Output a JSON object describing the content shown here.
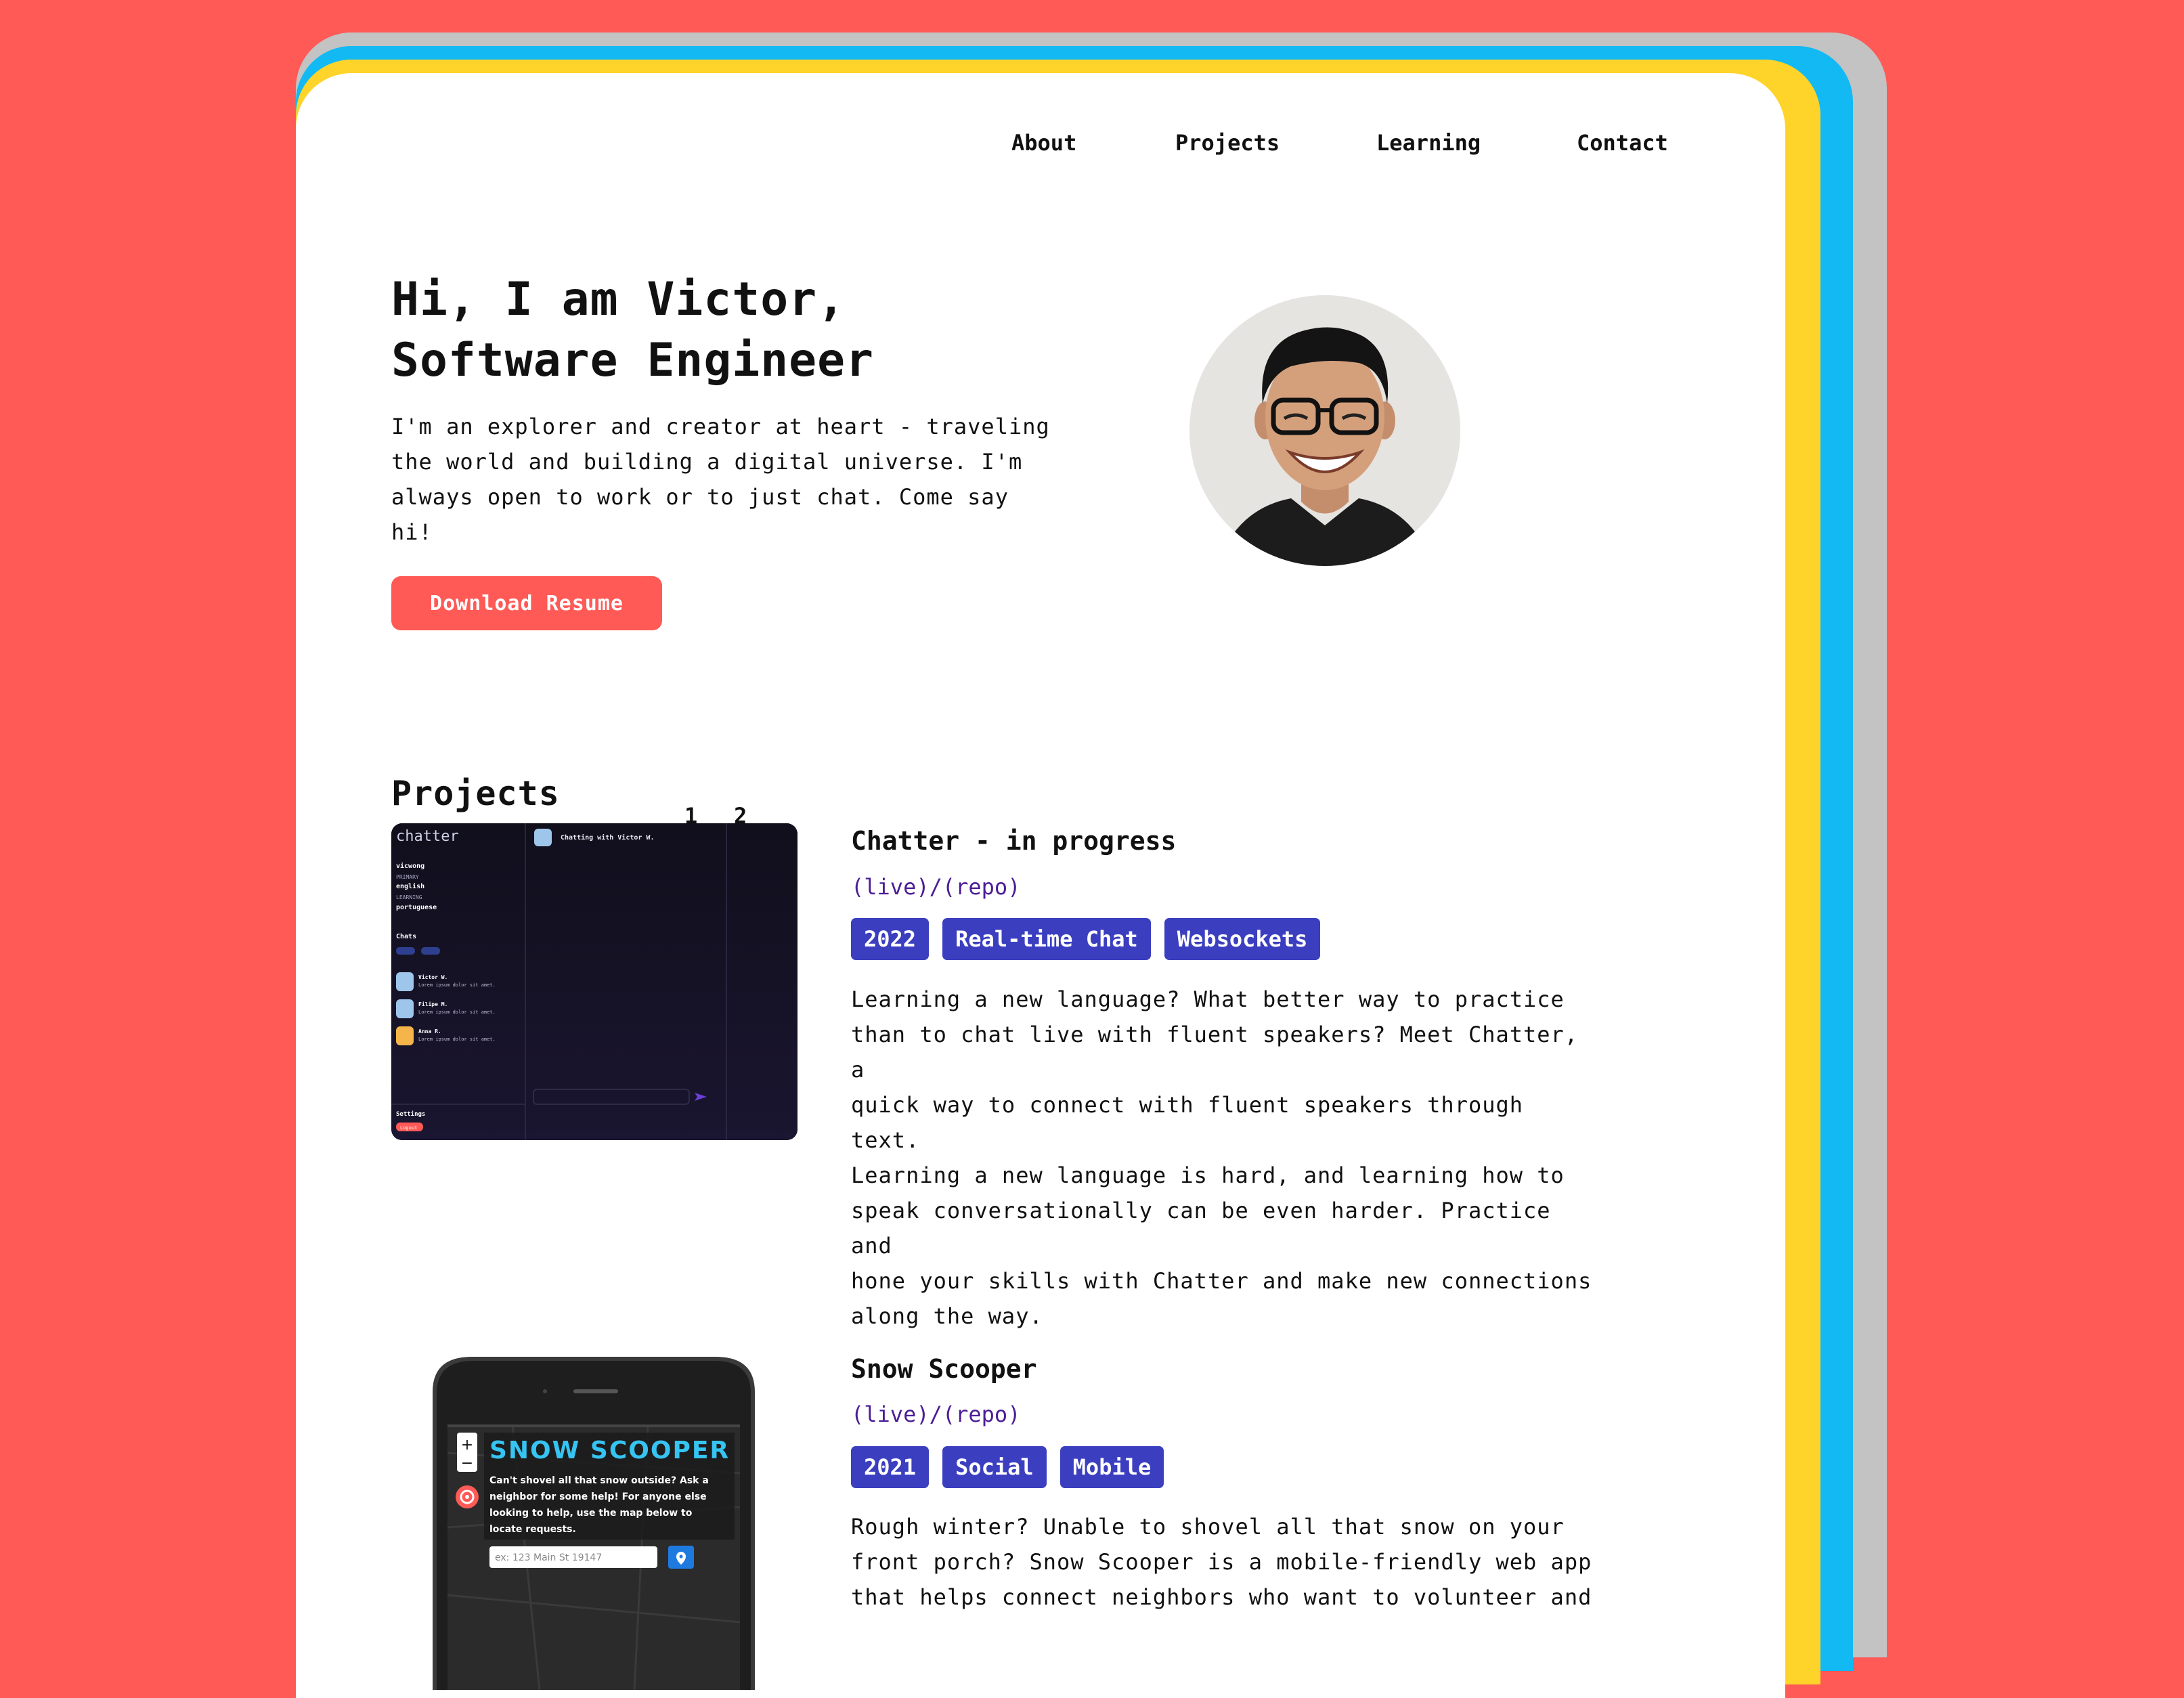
{
  "nav": {
    "about": "About",
    "projects": "Projects",
    "learning": "Learning",
    "contact": "Contact"
  },
  "hero": {
    "title_line1": "Hi, I am Victor,",
    "title_line2": "Software Engineer",
    "intro_line1": "I'm an explorer and creator at heart - traveling",
    "intro_line2": "the world and building a digital universe. I'm",
    "intro_line3": "always open to work or to just chat. Come say hi!",
    "resume_button": "Download Resume"
  },
  "projects_section": {
    "title": "Projects",
    "pages": [
      "1",
      "2"
    ]
  },
  "projects": [
    {
      "title": "Chatter - in progress",
      "live": "(live)",
      "separator": "/",
      "repo": "(repo)",
      "tags": [
        "2022",
        "Real-time Chat",
        "Websockets"
      ],
      "description_lines": [
        "Learning a new language? What better way to practice",
        "than to chat live with fluent speakers? Meet Chatter, a",
        "quick way to connect with fluent speakers through text.",
        "Learning a new language is hard, and learning how to",
        "speak conversationally can be even harder. Practice and",
        "hone your skills with Chatter and make new connections",
        "along the way."
      ],
      "screenshot": {
        "logo": "chatter",
        "header": "Chatting with Victor W.",
        "user": "vicwong",
        "primary_label": "PRIMARY",
        "primary_lang": "english",
        "learning_label": "LEARNING",
        "learning_lang": "portuguese",
        "chats_label": "Chats",
        "chats": [
          {
            "name": "Victor W.",
            "msg": "Lorem ipsum dolor sit amet."
          },
          {
            "name": "Filipe M.",
            "msg": "Lorem ipsum dolor sit amet."
          },
          {
            "name": "Anna R.",
            "msg": "Lorem ipsum dolor sit amet."
          }
        ],
        "settings": "Settings",
        "logout": "Logout"
      }
    },
    {
      "title": "Snow Scooper",
      "live": "(live)",
      "separator": "/",
      "repo": "(repo)",
      "tags": [
        "2021",
        "Social",
        "Mobile"
      ],
      "description_lines": [
        "Rough winter? Unable to shovel all that snow on your",
        "front porch? Snow Scooper is a mobile-friendly web app",
        "that helps connect neighbors who want to volunteer and"
      ],
      "screenshot": {
        "logo": "SNOW SCOOPER",
        "blurb_lines": [
          "Can't shovel all that snow outside? Ask a",
          "neighbor for some help! For anyone else",
          "looking to help, use the map below to",
          "locate requests."
        ],
        "address_placeholder": "ex: 123 Main St 19147",
        "zoom_in": "+",
        "zoom_out": "−"
      }
    }
  ],
  "colors": {
    "background": "#ff5a56",
    "accent": "#ff5a56",
    "tag": "#3b3fbf",
    "link": "#4b1d96",
    "frame_yellow": "#ffd42a",
    "frame_blue": "#12b9f2",
    "frame_gray": "#c3c3c3"
  }
}
